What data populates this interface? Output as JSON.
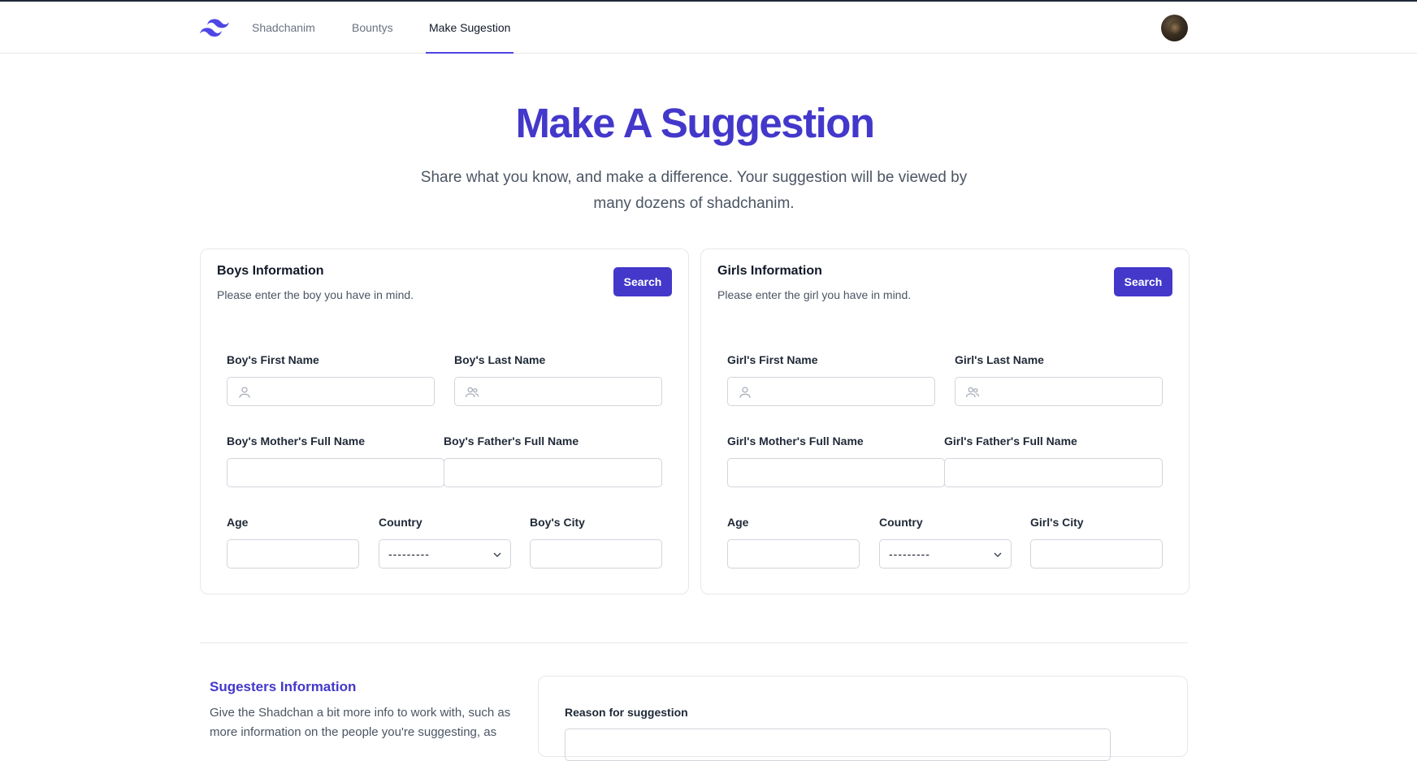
{
  "nav": {
    "items": [
      {
        "label": "Shadchanim"
      },
      {
        "label": "Bountys"
      },
      {
        "label": "Make Sugestion"
      }
    ]
  },
  "hero": {
    "title": "Make A Suggestion",
    "subtitle": "Share what you know, and make a difference. Your suggestion will be viewed by many dozens of shadchanim."
  },
  "boys": {
    "title": "Boys Information",
    "description": "Please enter the boy you have in mind.",
    "search_label": "Search",
    "first_name_label": "Boy's First Name",
    "last_name_label": "Boy's Last Name",
    "mother_label": "Boy's Mother's Full Name",
    "father_label": "Boy's Father's Full Name",
    "age_label": "Age",
    "country_label": "Country",
    "country_value": "---------",
    "city_label": "Boy's City"
  },
  "girls": {
    "title": "Girls Information",
    "description": "Please enter the girl you have in mind.",
    "search_label": "Search",
    "first_name_label": "Girl's First Name",
    "last_name_label": "Girl's Last Name",
    "mother_label": "Girl's Mother's Full Name",
    "father_label": "Girl's Father's Full Name",
    "age_label": "Age",
    "country_label": "Country",
    "country_value": "---------",
    "city_label": "Girl's City"
  },
  "suggester": {
    "title": "Sugesters Information",
    "description": "Give the Shadchan a bit more info to work with, such as more information on the people you're suggesting, as",
    "reason_label": "Reason for suggestion"
  },
  "colors": {
    "accent": "#4338ca",
    "nav_active_underline": "#4f46e5"
  },
  "icons": {
    "logo": "tailwind-wave-logo",
    "first_name": "user-icon",
    "last_name": "users-icon",
    "select": "chevron-down-icon"
  }
}
